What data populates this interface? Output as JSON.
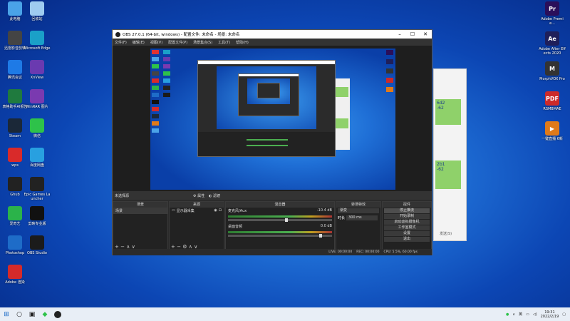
{
  "desktop_left": [
    {
      "label": "此电脑",
      "icon": "computer-icon",
      "color": "#4aa3e8"
    },
    {
      "label": "回收站",
      "icon": "recycle-bin-icon",
      "color": "#9ecbf0"
    },
    {
      "label": "迅雷影音剪辑",
      "icon": "app-icon",
      "color": "#444"
    },
    {
      "label": "Microsoft Edge",
      "icon": "edge-icon",
      "color": "#1aa0c8"
    },
    {
      "label": "腾讯会议",
      "icon": "meeting-icon",
      "color": "#1e7ae6"
    },
    {
      "label": "XnView",
      "icon": "xnview-icon",
      "color": "#6a3ab0"
    },
    {
      "label": "表格助手AI报告",
      "icon": "excel-icon",
      "color": "#1f7a3e"
    },
    {
      "label": "WinRAR 图片",
      "icon": "winrar-icon",
      "color": "#7a3ab0"
    },
    {
      "label": "Steam",
      "icon": "steam-icon",
      "color": "#1b2838"
    },
    {
      "label": "微信",
      "icon": "wechat-icon",
      "color": "#2ec24a"
    },
    {
      "label": "wps",
      "icon": "wps-icon",
      "color": "#d92a2a"
    },
    {
      "label": "百度网盘",
      "icon": "baidu-icon",
      "color": "#28a0e0"
    },
    {
      "label": "Ghub",
      "icon": "gaming-icon",
      "color": "#222"
    },
    {
      "label": "Epic Games Launcher",
      "icon": "epic-icon",
      "color": "#222"
    },
    {
      "label": "爱奇艺",
      "icon": "iqiyi-icon",
      "color": "#2bb34a"
    },
    {
      "label": "剪映专业版",
      "icon": "video-icon",
      "color": "#111"
    },
    {
      "label": "Photoshop",
      "icon": "disk-icon",
      "color": "#1e6cc8"
    },
    {
      "label": "OBS Studio",
      "icon": "obs-icon",
      "color": "#1b1b1b"
    },
    {
      "label": "Adobe 渲染",
      "icon": "adobe-icon",
      "color": "#d52a2a"
    }
  ],
  "desktop_right": [
    {
      "label": "Adobe Premie...",
      "icon": "premiere-icon",
      "color": "#2a0f5a",
      "text": "Pr"
    },
    {
      "label": "Adobe After Effects 2020",
      "icon": "after-effects-icon",
      "color": "#1f1f5a",
      "text": "Ae"
    },
    {
      "label": "MorphVOX Pro",
      "icon": "morphvox-icon",
      "color": "#333",
      "text": "M"
    },
    {
      "label": "RSMBMAE",
      "icon": "pdf-icon",
      "color": "#cc2a2a",
      "text": "PDF"
    },
    {
      "label": "一键直播 6新",
      "icon": "live-icon",
      "color": "#e07a1a",
      "text": "▶"
    }
  ],
  "obs": {
    "title": "OBS 27.0.1 (64-bit, windows) - 配置文件: 未命名 - 场景: 未命名",
    "menu": [
      "文件(F)",
      "编辑(E)",
      "视图(V)",
      "配置文件(P)",
      "场景集合(S)",
      "工具(T)",
      "帮助(H)"
    ],
    "scene_bar": "未选择源",
    "scene_bar_props": "⚙ 属性",
    "scene_bar_filter": "◐ 滤镜",
    "docks": {
      "scenes": {
        "title": "场景",
        "items": [
          "场景"
        ]
      },
      "sources": {
        "title": "来源",
        "items": [
          "显示器采集"
        ]
      },
      "mixer": {
        "title": "混音器",
        "tracks": [
          {
            "name": "麦克风/Aux",
            "db": "-10.4 dB"
          },
          {
            "name": "桌面音频",
            "db": "0.0 dB"
          }
        ]
      },
      "transitions": {
        "title": "转场特效",
        "type": "渐变",
        "duration_label": "时长",
        "duration": "300 ms"
      },
      "controls": {
        "title": "控件",
        "buttons": [
          "停止推流",
          "开始录制",
          "启动虚拟摄像机",
          "工作室模式",
          "设置",
          "退出"
        ]
      }
    },
    "status": {
      "live": "LIVE: 00:00:00",
      "rec": "REC: 00:00:00",
      "cpu": "CPU: 5.5%, 60.00 fps"
    }
  },
  "white_window": {
    "values": [
      "6d2",
      "-62",
      "2b1",
      "-62"
    ],
    "footer": "发送(S)"
  },
  "taskbar": {
    "time": "19:31",
    "date": "2022/2/19"
  }
}
